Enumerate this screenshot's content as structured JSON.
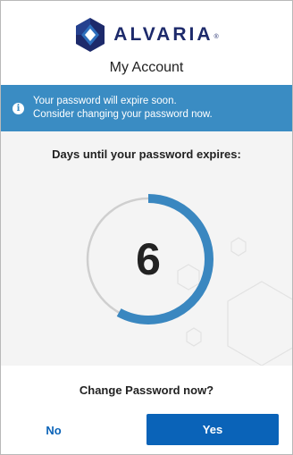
{
  "brand": {
    "name": "ALVARIA",
    "registered_mark": "®"
  },
  "page_title": "My Account",
  "banner": {
    "icon": "info-icon",
    "line1": "Your password will expire soon.",
    "line2": "Consider changing your password now."
  },
  "expiry": {
    "label": "Days until your password expires:",
    "days": "6",
    "ring_fill_fraction": 0.58
  },
  "prompt": {
    "question": "Change Password now?",
    "no_label": "No",
    "yes_label": "Yes"
  },
  "colors": {
    "brand_navy": "#1d2a6b",
    "brand_blue": "#2e6fbd",
    "banner_blue": "#3a8cc3",
    "ring_blue": "#3a87c0",
    "ring_track": "#cfcfcf",
    "button_blue": "#0a63b8"
  }
}
